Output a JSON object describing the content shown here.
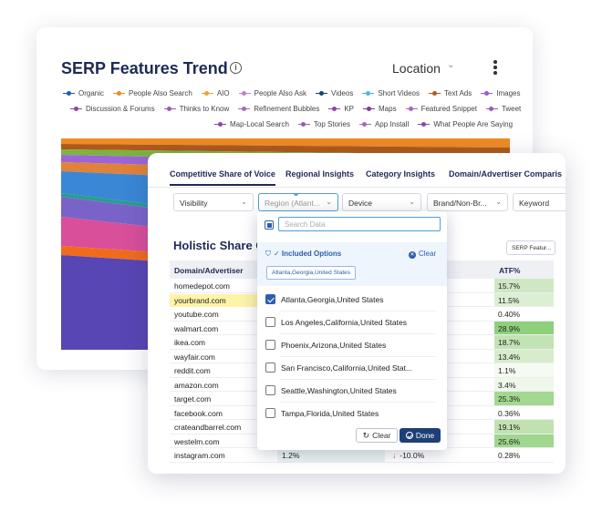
{
  "trend": {
    "title": "SERP Features Trend",
    "info_icon": "info-icon",
    "location_label": "Location",
    "legend": [
      [
        {
          "name": "Organic",
          "color": "#1f5fb0"
        },
        {
          "name": "People Also Search",
          "color": "#f08a24"
        },
        {
          "name": "AIO",
          "color": "#f0a030"
        },
        {
          "name": "People Also Ask",
          "color": "#c77be0"
        },
        {
          "name": "Videos",
          "color": "#1e3f76"
        },
        {
          "name": "Short Videos",
          "color": "#4db8e0"
        },
        {
          "name": "Text Ads",
          "color": "#b05a1a"
        },
        {
          "name": "Images",
          "color": "#9b59d6"
        }
      ],
      [
        {
          "name": "Discussion & Forums",
          "color": "#8e44ad"
        },
        {
          "name": "Thinks to Know",
          "color": "#9b59b6"
        },
        {
          "name": "Refinement Bubbles",
          "color": "#a569bd"
        },
        {
          "name": "KP",
          "color": "#8e44ad"
        },
        {
          "name": "Maps",
          "color": "#7d3c98"
        },
        {
          "name": "Featured Snippet",
          "color": "#a569bd"
        },
        {
          "name": "Tweet",
          "color": "#9b59b6"
        }
      ],
      [
        {
          "name": "Map-Local Search",
          "color": "#8e44ad"
        },
        {
          "name": "Top Stories",
          "color": "#9b59b6"
        },
        {
          "name": "App Install",
          "color": "#a569bd"
        },
        {
          "name": "What People Are Saying",
          "color": "#8e44ad"
        }
      ]
    ]
  },
  "share": {
    "tabs": [
      "Competitive Share of Voice",
      "Regional Insights",
      "Category Insights",
      "Domain/Advertiser Comparis"
    ],
    "filters": {
      "visibility": "Visibility",
      "region": "Region (Atlant...",
      "device": "Device",
      "brand": "Brand/Non-Br...",
      "keyword": "Keyword"
    },
    "title": "Holistic Share C",
    "serp_button": "SERP Featur...",
    "columns": {
      "domain": "Domain/Advertiser",
      "atf": "ATF%"
    },
    "rows": [
      {
        "domain": "homedepot.com",
        "atf": "15.7%",
        "atf_color": "#cfe8c3"
      },
      {
        "domain": "yourbrand.com",
        "atf": "11.5%",
        "atf_color": "#dcefd2",
        "highlight": true
      },
      {
        "domain": "youtube.com",
        "atf": "0.40%",
        "atf_color": "#ffffff"
      },
      {
        "domain": "walmart.com",
        "atf": "28.9%",
        "atf_color": "#8fd07c"
      },
      {
        "domain": "ikea.com",
        "atf": "18.7%",
        "atf_color": "#c2e3b3"
      },
      {
        "domain": "wayfair.com",
        "atf": "13.4%",
        "atf_color": "#d6ecca"
      },
      {
        "domain": "reddit.com",
        "atf": "1.1%",
        "atf_color": "#f5faf2"
      },
      {
        "domain": "amazon.com",
        "atf": "3.4%",
        "atf_color": "#eef7e9"
      },
      {
        "domain": "target.com",
        "atf": "25.3%",
        "atf_color": "#a2d890"
      },
      {
        "domain": "facebook.com",
        "atf": "0.36%",
        "atf_color": "#ffffff"
      },
      {
        "domain": "crateandbarrel.com",
        "atf": "19.1%",
        "atf_color": "#c0e2b0"
      },
      {
        "domain": "westelm.com",
        "atf": "25.6%",
        "atf_color": "#a0d78e"
      },
      {
        "domain": "instagram.com",
        "atf": "0.28%",
        "atf_color": "#ffffff",
        "share": "1.2%",
        "change": "-10.0%"
      }
    ]
  },
  "dropdown": {
    "search_placeholder": "Search Data",
    "included_label": "✓ Included Options",
    "clear_link": "Clear",
    "chip": "Atlanta,Georgia,United States",
    "options": [
      {
        "label": "Atlanta,Georgia,United States",
        "checked": true
      },
      {
        "label": "Los Angeles,California,United States",
        "checked": false
      },
      {
        "label": "Phoenix,Arizona,United States",
        "checked": false
      },
      {
        "label": "San Francisco,California,United Stat...",
        "checked": false
      },
      {
        "label": "Seattle,Washington,United States",
        "checked": false
      },
      {
        "label": "Tampa,Florida,United States",
        "checked": false
      }
    ],
    "clear_button": "Clear",
    "done_button": "Done"
  },
  "colors": {
    "navy": "#1e2a55",
    "accent": "#2c5fad",
    "done": "#1e3f76"
  }
}
